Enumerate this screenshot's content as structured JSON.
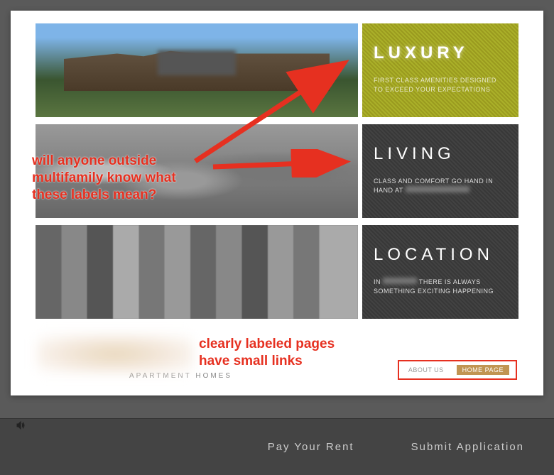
{
  "features": [
    {
      "title": "LUXURY",
      "desc": "FIRST CLASS AMENITIES DESIGNED TO EXCEED YOUR EXPECTATIONS"
    },
    {
      "title": "LIVING",
      "desc_prefix": "CLASS AND COMFORT GO HAND IN HAND AT "
    },
    {
      "title": "LOCATION",
      "desc_prefix": "IN ",
      "desc_suffix": " THERE IS ALWAYS SOMETHING EXCITING HAPPENING"
    }
  ],
  "logo_subtitle": "APARTMENT HOMES",
  "nav": {
    "about": "ABOUT US",
    "home": "HOME PAGE"
  },
  "bottom": {
    "rent": "Pay Your Rent",
    "apply": "Submit Application"
  },
  "annotations": {
    "q1": "will anyone outside\nmultifamily know what\nthese labels mean?",
    "q2": "clearly labeled pages\nhave small links"
  }
}
